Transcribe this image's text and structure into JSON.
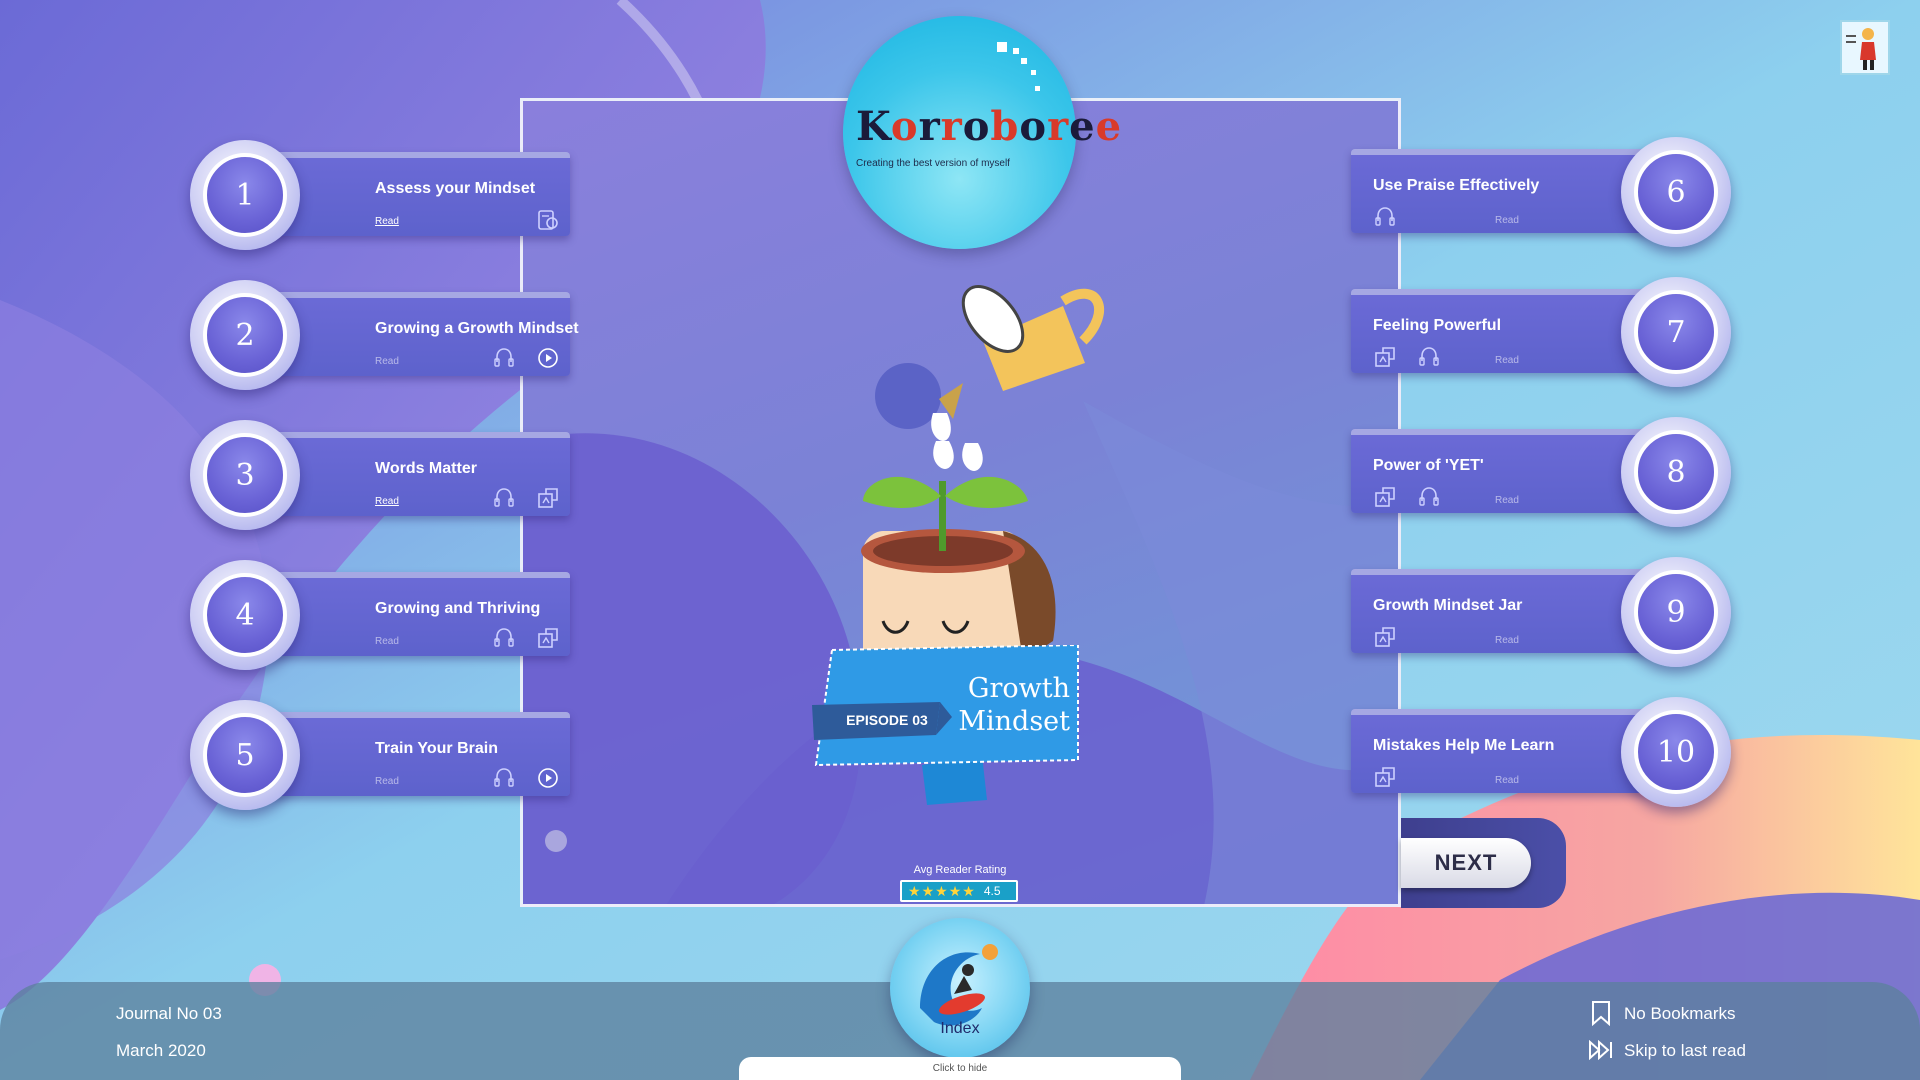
{
  "app": {
    "logo_text": [
      "K",
      "o",
      "r",
      "r",
      "o",
      "b",
      "o",
      "r",
      "e",
      "e"
    ],
    "tagline": "Creating the best version of myself"
  },
  "episode": {
    "label": "EPISODE 03",
    "title_line1": "Growth",
    "title_line2": "Mindset"
  },
  "rating": {
    "label": "Avg Reader Rating",
    "stars": 5,
    "value": "4.5"
  },
  "chapters_left": [
    {
      "num": "1",
      "title": "Assess your Mindset",
      "read": "Read",
      "read_active": true,
      "icons": [
        "quiz-icon"
      ]
    },
    {
      "num": "2",
      "title": "Growing a Growth Mindset",
      "read": "Read",
      "read_active": false,
      "icons": [
        "listen-icon",
        "play-icon"
      ]
    },
    {
      "num": "3",
      "title": "Words Matter",
      "read": "Read",
      "read_active": true,
      "icons": [
        "listen-icon",
        "activity-icon"
      ]
    },
    {
      "num": "4",
      "title": "Growing and Thriving",
      "read": "Read",
      "read_active": false,
      "icons": [
        "listen-icon",
        "activity-icon"
      ]
    },
    {
      "num": "5",
      "title": "Train Your Brain",
      "read": "Read",
      "read_active": false,
      "icons": [
        "listen-icon",
        "play-icon"
      ]
    }
  ],
  "chapters_right": [
    {
      "num": "6",
      "title": "Use Praise Effectively",
      "read": "Read",
      "icons": [
        "listen-icon"
      ]
    },
    {
      "num": "7",
      "title": "Feeling Powerful",
      "read": "Read",
      "icons": [
        "activity-icon",
        "listen-icon"
      ]
    },
    {
      "num": "8",
      "title": "Power of 'YET'",
      "read": "Read",
      "icons": [
        "activity-icon",
        "listen-icon"
      ]
    },
    {
      "num": "9",
      "title": "Growth Mindset Jar",
      "read": "Read",
      "icons": [
        "activity-icon"
      ]
    },
    {
      "num": "10",
      "title": "Mistakes Help Me Learn",
      "read": "Read",
      "icons": [
        "activity-icon"
      ]
    }
  ],
  "nav": {
    "next_label": "NEXT",
    "index_label": "Index",
    "hide_label": "Click to hide"
  },
  "footer": {
    "journal": "Journal No 03",
    "date": "March 2020",
    "bookmarks": "No Bookmarks",
    "skip": "Skip to last read"
  },
  "colors": {
    "accent": "#5d62cc",
    "circle": "#6a63d6",
    "star": "#ffd43a",
    "rating_bg": "#1aa0c8"
  }
}
